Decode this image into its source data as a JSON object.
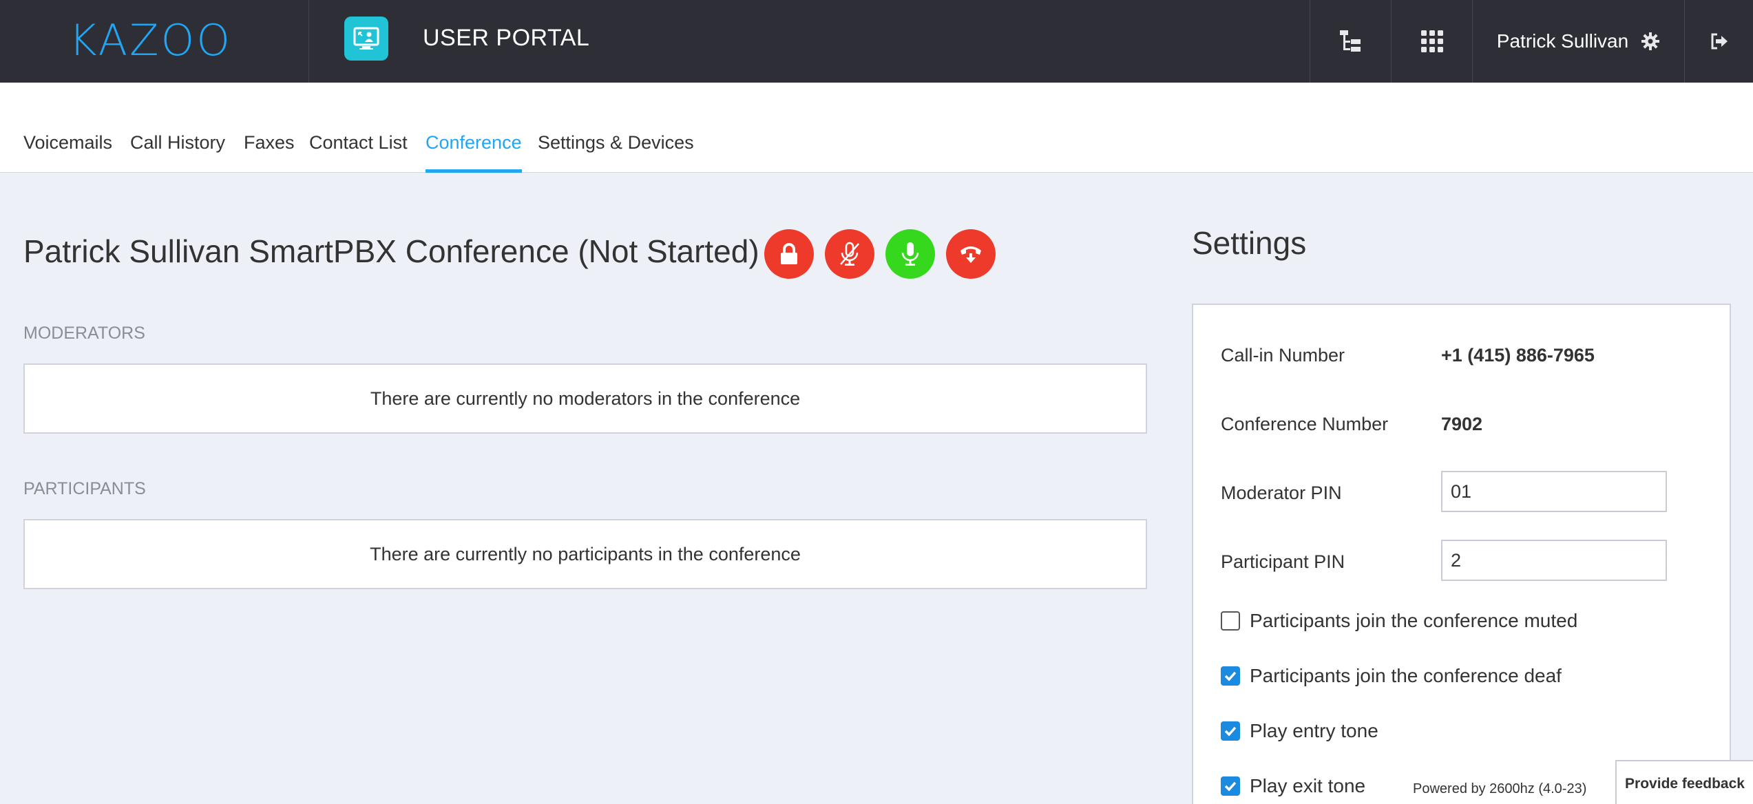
{
  "header": {
    "logo": "KAZOO",
    "app_title": "USER PORTAL",
    "user_name": "Patrick Sullivan"
  },
  "icons": {
    "app": "user-portal-icon",
    "tree": "account-tree-icon",
    "apps": "app-grid-icon",
    "settings": "gear-icon",
    "logout": "logout-icon"
  },
  "tabs": [
    {
      "label": "Voicemails",
      "active": false
    },
    {
      "label": "Call History",
      "active": false
    },
    {
      "label": "Faxes",
      "active": false
    },
    {
      "label": "Contact List",
      "active": false
    },
    {
      "label": "Conference",
      "active": true
    },
    {
      "label": "Settings & Devices",
      "active": false
    }
  ],
  "conference": {
    "title": "Patrick Sullivan SmartPBX Conference (Not Started)",
    "controls": [
      {
        "name": "lock-icon",
        "color": "#ee3a2b"
      },
      {
        "name": "mute-all-icon",
        "color": "#ee3a2b"
      },
      {
        "name": "unmute-all-icon",
        "color": "#36d81e"
      },
      {
        "name": "hangup-icon",
        "color": "#ee3a2b"
      }
    ],
    "moderators_label": "MODERATORS",
    "moderators_empty": "There are currently no moderators in the conference",
    "participants_label": "PARTICIPANTS",
    "participants_empty": "There are currently no participants in the conference"
  },
  "settings": {
    "title": "Settings",
    "call_in_label": "Call-in Number",
    "call_in_value": "+1 (415) 886-7965",
    "conf_number_label": "Conference Number",
    "conf_number_value": "7902",
    "moderator_pin_label": "Moderator PIN",
    "moderator_pin_value": "01",
    "participant_pin_label": "Participant PIN",
    "participant_pin_value": "2",
    "options": [
      {
        "label": "Participants join the conference muted",
        "checked": false
      },
      {
        "label": "Participants join the conference deaf",
        "checked": true
      },
      {
        "label": "Play entry tone",
        "checked": true
      },
      {
        "label": "Play exit tone",
        "checked": true
      }
    ]
  },
  "footer": {
    "powered_by": "Powered by 2600hz  (4.0-23)",
    "feedback": "Provide feedback"
  },
  "colors": {
    "accent": "#22a5f2",
    "topbar": "#2d2e36",
    "danger": "#ee3a2b",
    "success": "#36d81e"
  }
}
